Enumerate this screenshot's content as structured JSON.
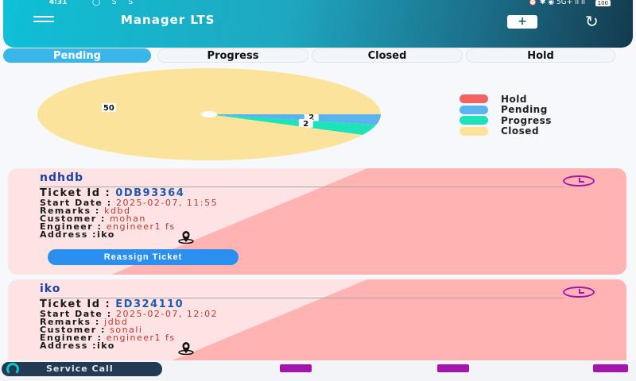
{
  "status_bar": {
    "time": "4:31",
    "apps": "◯ S S",
    "right": "⏰ ✱ ◉ 5G+ ıl ıl",
    "battery": "100"
  },
  "header": {
    "title": "Manager LTS",
    "add_label": "+",
    "refresh_glyph": "↻"
  },
  "tabs": [
    {
      "label": "Pending",
      "active": true
    },
    {
      "label": "Progress",
      "active": false
    },
    {
      "label": "Closed",
      "active": false
    },
    {
      "label": "Hold",
      "active": false
    }
  ],
  "colors": {
    "hold": "#f26262",
    "pending": "#5ab2ef",
    "progress": "#1fe3b8",
    "closed": "#fbe39c",
    "accent": "#3bb6ea"
  },
  "chart_data": {
    "type": "pie",
    "slices": [
      {
        "label": "Hold",
        "value": 0
      },
      {
        "label": "Pending",
        "value": 2
      },
      {
        "label": "Progress",
        "value": 2
      },
      {
        "label": "Closed",
        "value": 50
      }
    ],
    "data_labels": [
      "50",
      "2",
      "2"
    ],
    "legend": [
      "Hold",
      "Pending",
      "Progress",
      "Closed"
    ],
    "legend_position": "right"
  },
  "tickets": [
    {
      "title": "ndhdb",
      "ticket_id_label": "Ticket Id : ",
      "ticket_id": "0DB93364",
      "start_date_label": "Start Date : ",
      "start_date": "2025-02-07, 11:55",
      "remarks_label": "Remarks : ",
      "remarks": "kdbd",
      "customer_label": "Customer : ",
      "customer": "mohan",
      "engineer_label": "Engineer : ",
      "engineer": "engineer1 fs",
      "address_label": "Address :",
      "address": "iko",
      "button_label": "Reassign Ticket"
    },
    {
      "title": "iko",
      "ticket_id_label": "Ticket Id : ",
      "ticket_id": "ED324110",
      "start_date_label": "Start Date : ",
      "start_date": "2025-02-07, 12:02",
      "remarks_label": "Remarks : ",
      "remarks": "jdbd",
      "customer_label": "Customer : ",
      "customer": "sonali",
      "engineer_label": "Engineer : ",
      "engineer": "engineer1 fs",
      "address_label": "Address :",
      "address": "iko"
    }
  ],
  "bottom_bar": {
    "service_call_label": "Service Call"
  }
}
